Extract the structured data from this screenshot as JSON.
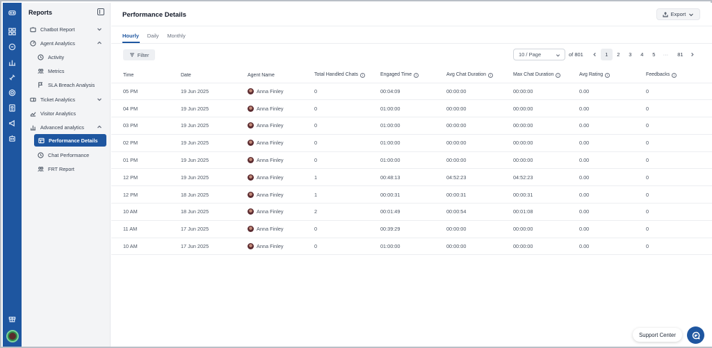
{
  "sidebar": {
    "title": "Reports",
    "items": [
      {
        "label": "Chatbot Report",
        "icon": "bot-icon"
      },
      {
        "label": "Agent Analytics",
        "icon": "gauge-icon"
      },
      {
        "label": "Activity",
        "icon": "clock-icon"
      },
      {
        "label": "Metrics",
        "icon": "users-icon"
      },
      {
        "label": "SLA Breach Analysis",
        "icon": "flag-icon"
      },
      {
        "label": "Ticket Analytics",
        "icon": "ticket-icon"
      },
      {
        "label": "Visitor Analytics",
        "icon": "trend-icon"
      },
      {
        "label": "Advanced analytics",
        "icon": "bar-chart-icon"
      },
      {
        "label": "Performance Details",
        "icon": "table-icon"
      },
      {
        "label": "Chat Performance",
        "icon": "clock-icon"
      },
      {
        "label": "FRT Report",
        "icon": "users-icon"
      }
    ]
  },
  "header": {
    "title": "Performance Details",
    "export_label": "Export"
  },
  "tabs": [
    {
      "label": "Hourly",
      "active": true
    },
    {
      "label": "Daily",
      "active": false
    },
    {
      "label": "Monthly",
      "active": false
    }
  ],
  "toolbar": {
    "filter_label": "Filter"
  },
  "pagination": {
    "page_size": "10 / Page",
    "of_label": "of 801",
    "pages": [
      "1",
      "2",
      "3",
      "4",
      "5",
      "···",
      "81"
    ],
    "current": "1"
  },
  "table": {
    "columns": [
      "Time",
      "Date",
      "Agent Name",
      "Total Handled Chats",
      "Engaged Time",
      "Avg Chat Duration",
      "Max Chat Duration",
      "Avg Rating",
      "Feedbacks"
    ],
    "rows": [
      [
        "05 PM",
        "19 Jun 2025",
        "Anna Finley",
        "0",
        "00:04:09",
        "00:00:00",
        "00:00:00",
        "0.00",
        "0"
      ],
      [
        "04 PM",
        "19 Jun 2025",
        "Anna Finley",
        "0",
        "01:00:00",
        "00:00:00",
        "00:00:00",
        "0.00",
        "0"
      ],
      [
        "03 PM",
        "19 Jun 2025",
        "Anna Finley",
        "0",
        "01:00:00",
        "00:00:00",
        "00:00:00",
        "0.00",
        "0"
      ],
      [
        "02 PM",
        "19 Jun 2025",
        "Anna Finley",
        "0",
        "01:00:00",
        "00:00:00",
        "00:00:00",
        "0.00",
        "0"
      ],
      [
        "01 PM",
        "19 Jun 2025",
        "Anna Finley",
        "0",
        "01:00:00",
        "00:00:00",
        "00:00:00",
        "0.00",
        "0"
      ],
      [
        "12 PM",
        "19 Jun 2025",
        "Anna Finley",
        "1",
        "00:48:13",
        "04:52:23",
        "04:52:23",
        "0.00",
        "0"
      ],
      [
        "12 PM",
        "18 Jun 2025",
        "Anna Finley",
        "1",
        "00:00:31",
        "00:00:31",
        "00:00:31",
        "0.00",
        "0"
      ],
      [
        "10 AM",
        "18 Jun 2025",
        "Anna Finley",
        "2",
        "00:01:49",
        "00:00:54",
        "00:01:08",
        "0.00",
        "0"
      ],
      [
        "11 AM",
        "17 Jun 2025",
        "Anna Finley",
        "0",
        "00:39:29",
        "00:00:00",
        "00:00:00",
        "0.00",
        "0"
      ],
      [
        "10 AM",
        "17 Jun 2025",
        "Anna Finley",
        "0",
        "01:00:00",
        "00:00:00",
        "00:00:00",
        "0.00",
        "0"
      ]
    ]
  },
  "footer": {
    "support_label": "Support Center"
  },
  "colors": {
    "accent": "#1e56a0",
    "sidebar_bg": "#f3f4f6"
  }
}
